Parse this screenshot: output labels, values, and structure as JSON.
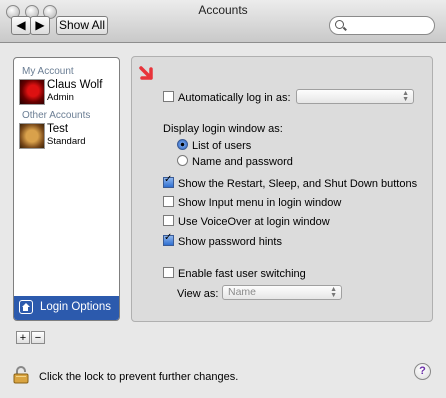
{
  "window": {
    "title": "Accounts"
  },
  "toolbar": {
    "back_label": "◀",
    "forward_label": "▶",
    "show_all_label": "Show All",
    "search_placeholder": ""
  },
  "sidebar": {
    "my_account_header": "My Account",
    "my_account": {
      "name": "Claus Wolf",
      "role": "Admin"
    },
    "other_accounts_header": "Other Accounts",
    "other_accounts": [
      {
        "name": "Test",
        "role": "Standard"
      }
    ],
    "login_options_label": "Login Options",
    "add_label": "+",
    "remove_label": "−"
  },
  "panel": {
    "auto_login": {
      "label": "Automatically log in as:",
      "checked": false,
      "popup_value": ""
    },
    "display_label": "Display login window as:",
    "radio_options": [
      {
        "label": "List of users",
        "selected": true
      },
      {
        "label": "Name and password",
        "selected": false
      }
    ],
    "checkboxes": [
      {
        "label": "Show the Restart, Sleep, and Shut Down buttons",
        "checked": true
      },
      {
        "label": "Show Input menu in login window",
        "checked": false
      },
      {
        "label": "Use VoiceOver at login window",
        "checked": false
      },
      {
        "label": "Show password hints",
        "checked": true
      }
    ],
    "fast_user_switching": {
      "label": "Enable fast user switching",
      "checked": false
    },
    "view_as": {
      "label": "View as:",
      "value": "Name"
    }
  },
  "footer": {
    "lock_text": "Click the lock to prevent further changes.",
    "help_label": "?"
  },
  "colors": {
    "selection": "#2c5aad",
    "annotation_arrow": "#e8343b"
  }
}
